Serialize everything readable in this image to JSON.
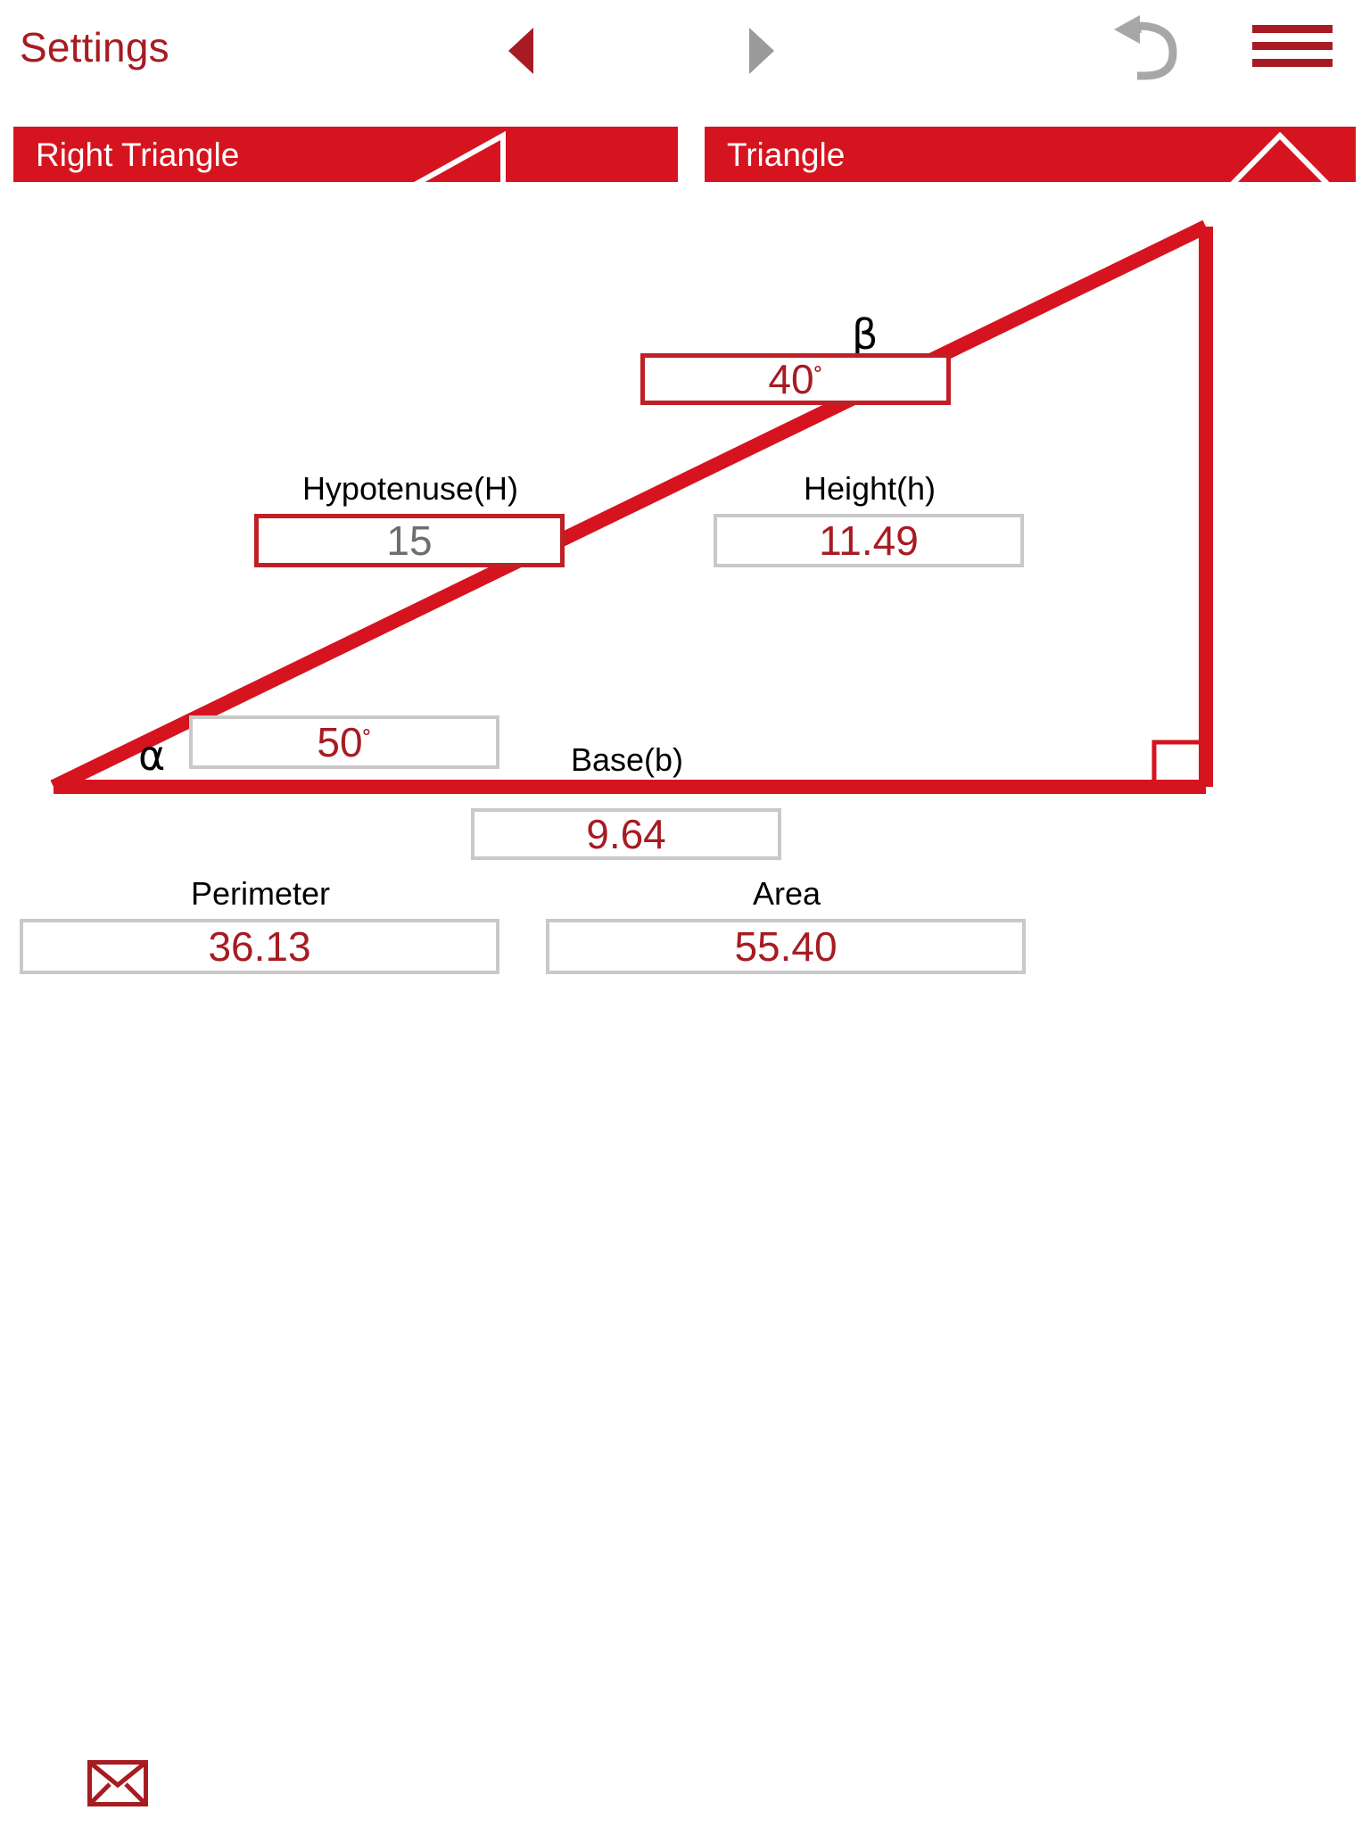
{
  "header": {
    "title": "Settings",
    "prev_icon": "triangle-left-icon",
    "next_icon": "triangle-right-icon",
    "undo_icon": "undo-arrow-icon",
    "menu_icon": "hamburger-menu-icon",
    "prev_enabled": "true",
    "next_enabled": "false",
    "undo_enabled": "false"
  },
  "tabs": [
    {
      "label": "Right Triangle",
      "icon": "right-triangle-icon",
      "selected": "true"
    },
    {
      "label": "Triangle",
      "icon": "triangle-icon",
      "selected": "false"
    }
  ],
  "diagram": {
    "alpha_symbol": "α",
    "beta_symbol": "β",
    "right_angle_marker": "square",
    "stroke_color": "#d5141f"
  },
  "fields": {
    "beta_angle": {
      "label": "",
      "value": "40",
      "unit": "˚",
      "state": "focused",
      "value_color": "#a61c22",
      "border_color": "#bf2026"
    },
    "hypotenuse": {
      "label": "Hypotenuse(H)",
      "value": "15",
      "unit": "",
      "state": "input",
      "value_color": "#6e6e6e",
      "border_color": "#bf2026"
    },
    "height": {
      "label": "Height(h)",
      "value": "11.49",
      "unit": "",
      "state": "computed",
      "value_color": "#a61c22",
      "border_color": "#c9c9c9"
    },
    "alpha_angle": {
      "label": "",
      "value": "50",
      "unit": "˚",
      "state": "computed",
      "value_color": "#a61c22",
      "border_color": "#c9c9c9"
    },
    "base": {
      "label": "Base(b)",
      "value": "9.64",
      "unit": "",
      "state": "computed",
      "value_color": "#a61c22",
      "border_color": "#c9c9c9"
    },
    "perimeter": {
      "label": "Perimeter",
      "value": "36.13",
      "unit": "",
      "state": "computed",
      "value_color": "#a61c22",
      "border_color": "#c9c9c9"
    },
    "area": {
      "label": "Area",
      "value": "55.40",
      "unit": "",
      "state": "computed",
      "value_color": "#a61c22",
      "border_color": "#c9c9c9"
    }
  },
  "footer": {
    "mail_icon": "envelope-icon"
  },
  "colors": {
    "brand_red": "#d5141f",
    "dark_red": "#a61c22",
    "field_border_gray": "#c9c9c9",
    "inactive_gray": "#9a9a9a",
    "input_gray": "#6e6e6e"
  }
}
